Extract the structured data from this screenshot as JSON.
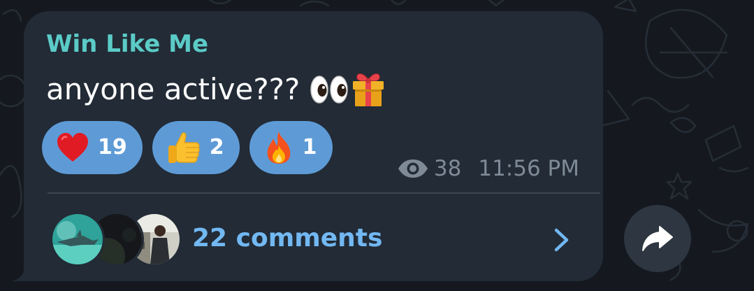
{
  "post": {
    "sender": "Win Like Me",
    "text": "anyone active???",
    "text_emojis": [
      "eyes-emoji",
      "gift-emoji"
    ],
    "reactions": [
      {
        "emoji": "red-heart-emoji",
        "count": "19"
      },
      {
        "emoji": "thumbs-up-emoji",
        "count": "2"
      },
      {
        "emoji": "fire-emoji",
        "count": "1"
      }
    ],
    "views": "38",
    "time": "11:56 PM",
    "comments": {
      "label": "22 comments",
      "avatars": [
        "shark-photo-avatar",
        "dark-photo-avatar",
        "person-photo-avatar"
      ]
    }
  },
  "share_icon": "share-forward-icon",
  "colors": {
    "background": "#15191f",
    "bubble": "#222b36",
    "sender": "#5bcbc7",
    "reaction_pill": "#5e9bd6",
    "meta": "#7f8a97",
    "comments_link": "#72b8f2",
    "share_button": "#2d3641"
  }
}
